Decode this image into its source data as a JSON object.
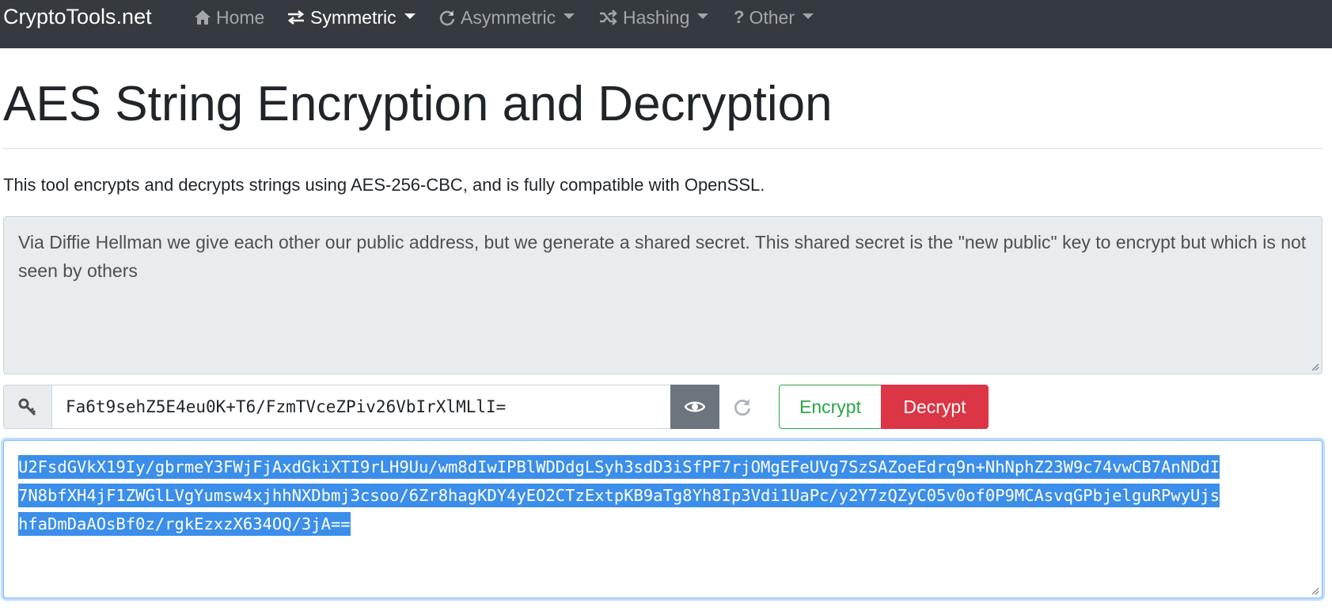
{
  "navbar": {
    "brand": "CryptoTools.net",
    "items": [
      {
        "label": "Home",
        "icon": "home-icon",
        "dropdown": false
      },
      {
        "label": "Symmetric",
        "icon": "exchange-icon",
        "dropdown": true,
        "active": true
      },
      {
        "label": "Asymmetric",
        "icon": "refresh-icon",
        "dropdown": true
      },
      {
        "label": "Hashing",
        "icon": "random-icon",
        "dropdown": true
      },
      {
        "label": "Other",
        "icon": "question-icon",
        "dropdown": true
      }
    ],
    "background": "#343a40"
  },
  "page": {
    "title": "AES String Encryption and Decryption",
    "lead": "This tool encrypts and decrypts strings using AES-256-CBC, and is fully compatible with OpenSSL."
  },
  "plaintext": {
    "value": "Via Diffie Hellman we give each other our public address, but we generate a shared secret. This shared secret is the \"new public\" key to encrypt but which is not seen by others"
  },
  "key_group": {
    "icon": "key-icon",
    "value": "Fa6t9sehZ5E4eu0K+T6/FzmTVceZPiv26VbIrXlMLlI=",
    "show_icon": "eye-icon",
    "regenerate_icon": "refresh-icon"
  },
  "buttons": {
    "encrypt": "Encrypt",
    "decrypt": "Decrypt"
  },
  "ciphertext": {
    "lines": [
      "U2FsdGVkX19Iy/gbrmeY3FWjFjAxdGkiXTI9rLH9Uu/wm8dIwIPBlWDDdgLSyh3sdD3iSfPF7rjOMgEFeUVg7SzSAZoeEdrq9n+NhNphZ23W9c74vwCB7AnNDdI",
      "7N8bfXH4jF1ZWGlLVgYumsw4xjhhNXDbmj3csoo/6Zr8hagKDY4yEO2CTzExtpKB9aTg8Yh8Ip3Vdi1UaPc/y2Y7zQZyC05v0of0P9MCAsvqGPbjelguRPwyUjs",
      "hfaDmDaAOsBf0z/rgkEzxzX634OQ/3jA=="
    ],
    "selected": true
  },
  "colors": {
    "success": "#28a745",
    "danger": "#dc3545",
    "secondary": "#6c757d",
    "selection": "#3b8eea"
  }
}
